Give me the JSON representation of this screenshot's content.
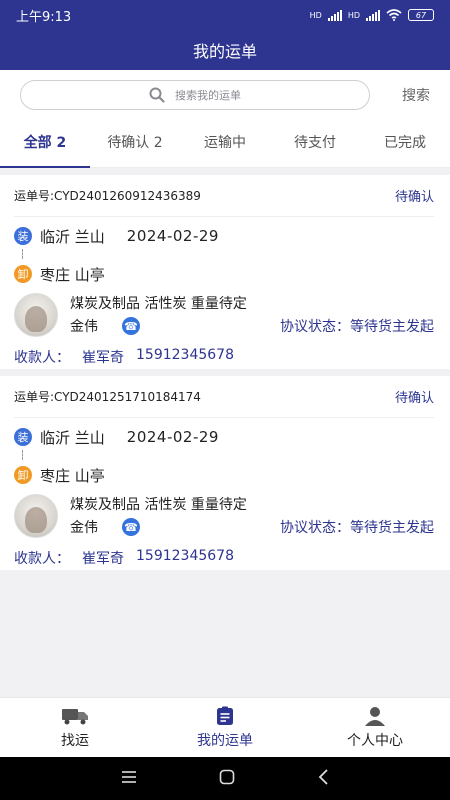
{
  "status_bar": {
    "time": "上午9:13",
    "battery": "67",
    "hd1": "HD",
    "hd2": "HD"
  },
  "header": {
    "title": "我的运单"
  },
  "search": {
    "placeholder": "搜索我的运单",
    "button": "搜索"
  },
  "tabs": [
    {
      "label": "全部 2",
      "active": true
    },
    {
      "label": "待确认 2",
      "active": false
    },
    {
      "label": "运输中",
      "active": false
    },
    {
      "label": "待支付",
      "active": false
    },
    {
      "label": "已完成",
      "active": false
    }
  ],
  "orders": [
    {
      "number": "运单号:CYD2401260912436389",
      "status": "待确认",
      "load_badge": "装",
      "origin": "临沂 兰山",
      "date": "2024-02-29",
      "unload_badge": "卸",
      "destination": "枣庄 山亭",
      "cargo": "煤炭及制品  活性炭 重量待定",
      "driver": "金伟",
      "agreement": "协议状态：等待货主发起",
      "payee_label": "收款人：",
      "payee_name": "崔军奇",
      "payee_phone": "15912345678"
    },
    {
      "number": "运单号:CYD2401251710184174",
      "status": "待确认",
      "load_badge": "装",
      "origin": "临沂 兰山",
      "date": "2024-02-29",
      "unload_badge": "卸",
      "destination": "枣庄 山亭",
      "cargo": "煤炭及制品  活性炭 重量待定",
      "driver": "金伟",
      "agreement": "协议状态：等待货主发起",
      "payee_label": "收款人：",
      "payee_name": "崔军奇",
      "payee_phone": "15912345678"
    }
  ],
  "bottom_nav": [
    {
      "label": "找运",
      "icon": "truck-icon",
      "active": false
    },
    {
      "label": "我的运单",
      "icon": "clipboard-icon",
      "active": true
    },
    {
      "label": "个人中心",
      "icon": "person-icon",
      "active": false
    }
  ],
  "colors": {
    "primary": "#2d3590",
    "load_badge": "#3d6fd8",
    "unload_badge": "#f09a25",
    "phone": "#3573dd"
  }
}
